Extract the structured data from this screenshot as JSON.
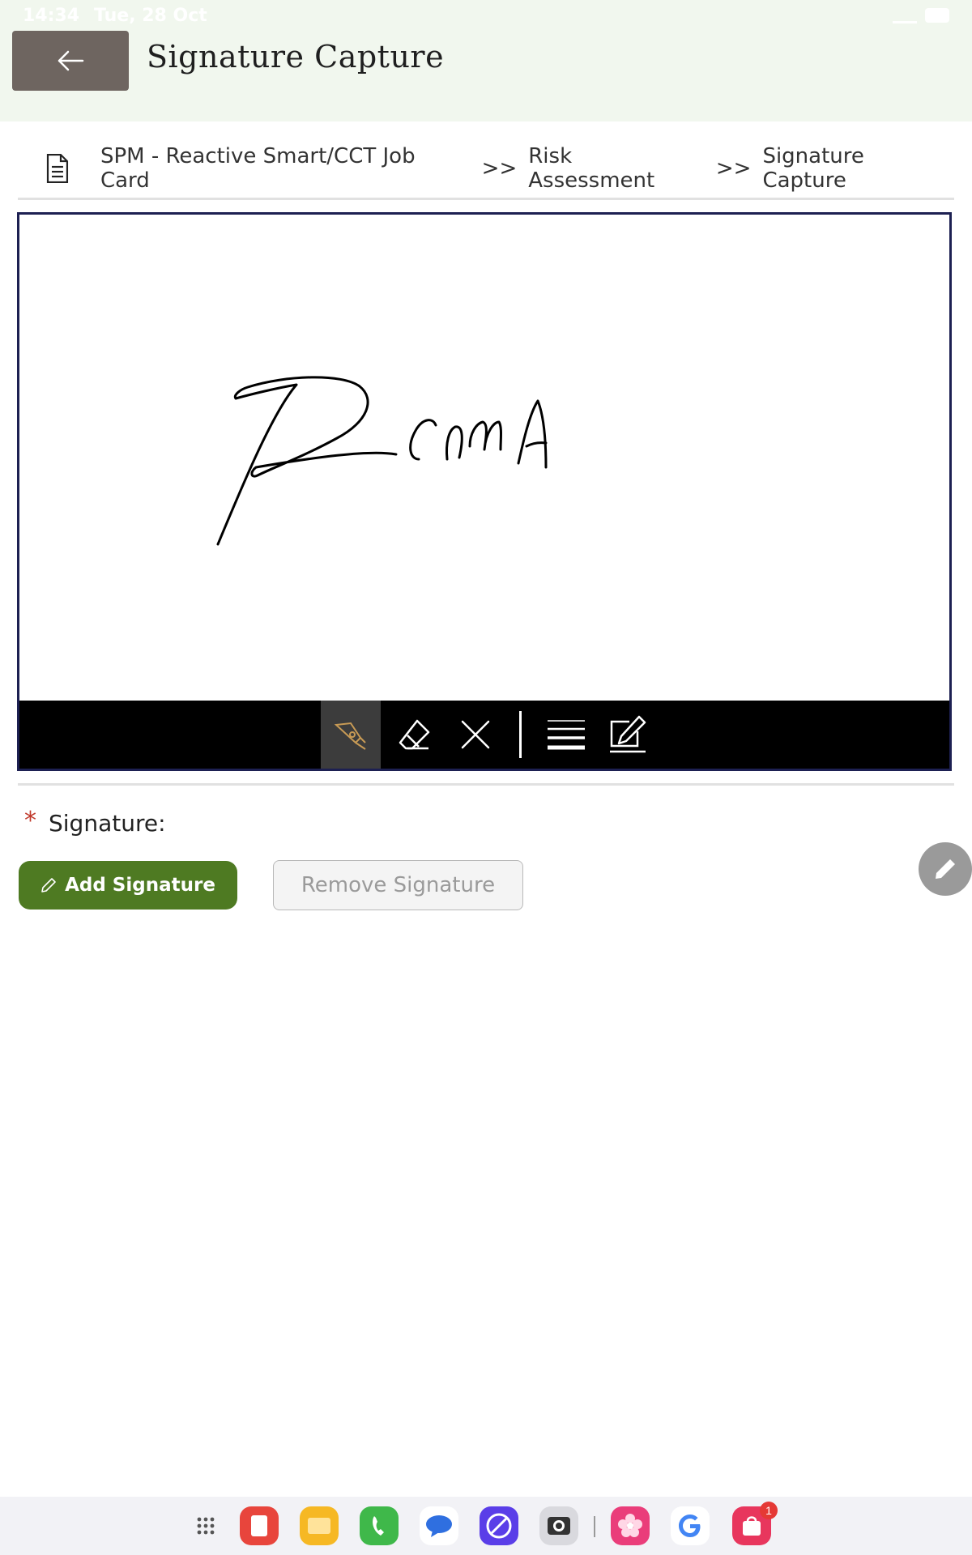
{
  "status_bar": {
    "time": "14:34",
    "date": "Tue, 28 Oct"
  },
  "header": {
    "title": "Signature Capture",
    "back_icon": "arrow-left-icon"
  },
  "breadcrumb": {
    "icon": "document-icon",
    "items": [
      "SPM - Reactive Smart/CCT Job Card",
      "Risk Assessment",
      "Signature Capture"
    ],
    "separator": ">>"
  },
  "signature_pad": {
    "tools": [
      "pen-icon",
      "eraser-icon",
      "clear-icon",
      "line-width-icon",
      "edit-icon"
    ],
    "active_tool": "pen-icon"
  },
  "form": {
    "required_marker": "*",
    "signature_label": "Signature:",
    "add_label": "Add Signature",
    "remove_label": "Remove Signature"
  },
  "dock": {
    "apps": [
      "apps-grid-icon",
      "notes-app-icon",
      "files-app-icon",
      "phone-app-icon",
      "messages-app-icon",
      "internet-app-icon",
      "camera-app-icon",
      "gallery-app-icon",
      "google-app-icon",
      "store-app-icon"
    ],
    "store_badge": "1"
  },
  "colors": {
    "accent": "#4e7a22",
    "header_bg": "#f1f7ee",
    "back_button": "#6e6560",
    "pad_border": "#1d2052"
  }
}
